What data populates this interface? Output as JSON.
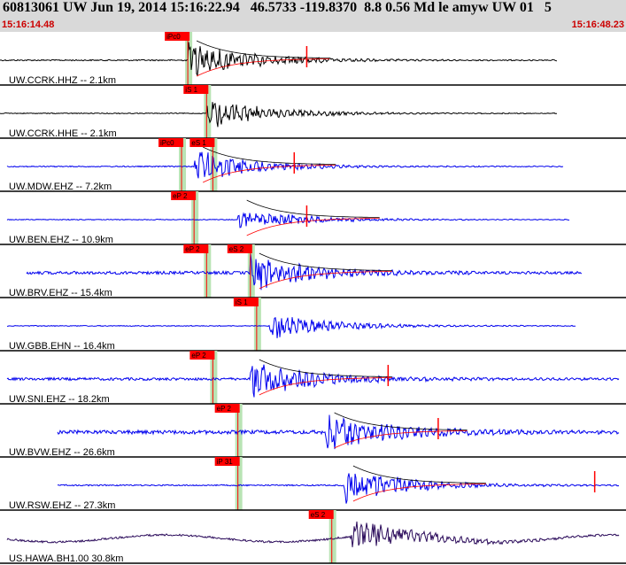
{
  "header": {
    "title": "60813061 UW Jun 19, 2014 15:16:22.94   46.5733 -119.8370  8.8 0.56 Md le amyw UW 01   5",
    "time_start": "15:16:14.48",
    "time_end": "15:16:48.23"
  },
  "colors": {
    "header_bg": "#d9d9d9",
    "time_text": "#cc0000",
    "pick": "#ff0000",
    "band": "#b9e4b4",
    "trace_black": "#000000",
    "trace_blue": "#0000ee",
    "trace_purple": "#2a0a5a"
  },
  "traces": [
    {
      "label": "UW.CCRK.HHZ -- 2.1km",
      "color": "black",
      "picks": [
        {
          "text": "iPc0",
          "t": 0.3
        }
      ],
      "s_mark": 0.5,
      "onset": 0.3,
      "end": 0.89,
      "noise": 0.12,
      "amp": 1.0,
      "coda_curve": true,
      "red_ticks": [
        0.49
      ]
    },
    {
      "label": "UW.CCRK.HHE -- 2.1km",
      "color": "black",
      "picks": [
        {
          "text": "iS 1",
          "t": 0.33
        }
      ],
      "s_mark": null,
      "onset": 0.33,
      "end": 0.89,
      "noise": 0.08,
      "amp": 0.85,
      "coda_curve": false,
      "red_ticks": []
    },
    {
      "label": "UW.MDW.EHZ -- 7.2km",
      "color": "blue",
      "picks": [
        {
          "text": "iPc0",
          "t": 0.29
        },
        {
          "text": "eS 1",
          "t": 0.34
        }
      ],
      "s_mark": null,
      "onset": 0.31,
      "end": 0.9,
      "noise": 0.1,
      "amp": 0.9,
      "coda_curve": true,
      "red_ticks": [
        0.47
      ]
    },
    {
      "label": "UW.BEN.EHZ -- 10.9km",
      "color": "blue",
      "picks": [
        {
          "text": "eP 2",
          "t": 0.31
        }
      ],
      "s_mark": null,
      "onset": 0.38,
      "end": 0.91,
      "noise": 0.08,
      "amp": 0.6,
      "coda_curve": true,
      "red_ticks": [
        0.49
      ]
    },
    {
      "label": "UW.BRV.EHZ -- 15.4km",
      "color": "blue",
      "picks": [
        {
          "text": "eP 2",
          "t": 0.33
        },
        {
          "text": "eS 2",
          "t": 0.4
        }
      ],
      "s_mark": null,
      "onset": 0.4,
      "end": 0.93,
      "noise": 0.28,
      "amp": 1.0,
      "coda_curve": true,
      "red_ticks": []
    },
    {
      "label": "UW.GBB.EHN -- 16.4km",
      "color": "blue",
      "picks": [
        {
          "text": "iS 1",
          "t": 0.41
        }
      ],
      "s_mark": null,
      "onset": 0.43,
      "end": 0.92,
      "noise": 0.08,
      "amp": 0.7,
      "coda_curve": false,
      "red_ticks": []
    },
    {
      "label": "UW.SNI.EHZ -- 18.2km",
      "color": "blue",
      "picks": [
        {
          "text": "eP 2",
          "t": 0.34
        }
      ],
      "s_mark": null,
      "onset": 0.4,
      "end": 0.99,
      "noise": 0.25,
      "amp": 1.0,
      "coda_curve": true,
      "red_ticks": [
        0.62
      ]
    },
    {
      "label": "UW.BVW.EHZ -- 26.6km",
      "color": "blue",
      "picks": [
        {
          "text": "eP 2",
          "t": 0.38
        }
      ],
      "s_mark": null,
      "onset": 0.52,
      "end": 0.99,
      "noise": 0.35,
      "amp": 1.0,
      "coda_curve": true,
      "red_ticks": [
        0.7
      ]
    },
    {
      "label": "UW.RSW.EHZ -- 27.3km",
      "color": "blue",
      "picks": [
        {
          "text": "iP 31",
          "t": 0.38
        }
      ],
      "s_mark": null,
      "onset": 0.55,
      "end": 0.99,
      "noise": 0.12,
      "amp": 1.0,
      "coda_curve": true,
      "red_ticks": [
        0.95
      ]
    },
    {
      "label": "US.HAWA.BH1.00 30.8km",
      "color": "purple",
      "picks": [
        {
          "text": "eS 2",
          "t": 0.53
        }
      ],
      "s_mark": null,
      "onset": 0.56,
      "end": 0.99,
      "noise": 0.18,
      "amp": 0.9,
      "coda_curve": false,
      "red_ticks": []
    }
  ]
}
